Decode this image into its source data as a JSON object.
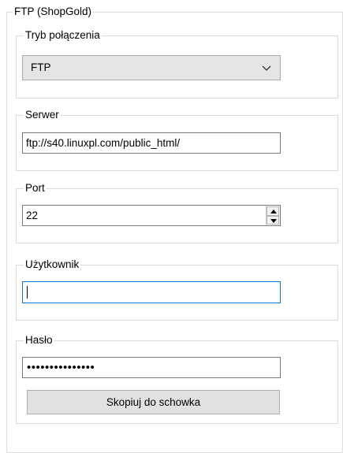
{
  "outer_group": {
    "title": "FTP (ShopGold)"
  },
  "connection_mode": {
    "title": "Tryb połączenia",
    "selected": "FTP"
  },
  "server": {
    "title": "Serwer",
    "value": "ftp://s40.linuxpl.com/public_html/"
  },
  "port": {
    "title": "Port",
    "value": "22"
  },
  "user": {
    "title": "Użytkownik",
    "value": ""
  },
  "password": {
    "title": "Hasło",
    "masked": "•••••••••••••••"
  },
  "copy_button": {
    "label": "Skopiuj do schowka"
  },
  "icons": {
    "dropdown": "chevron-down-icon",
    "spin_up": "arrow-up-icon",
    "spin_down": "arrow-down-icon"
  }
}
